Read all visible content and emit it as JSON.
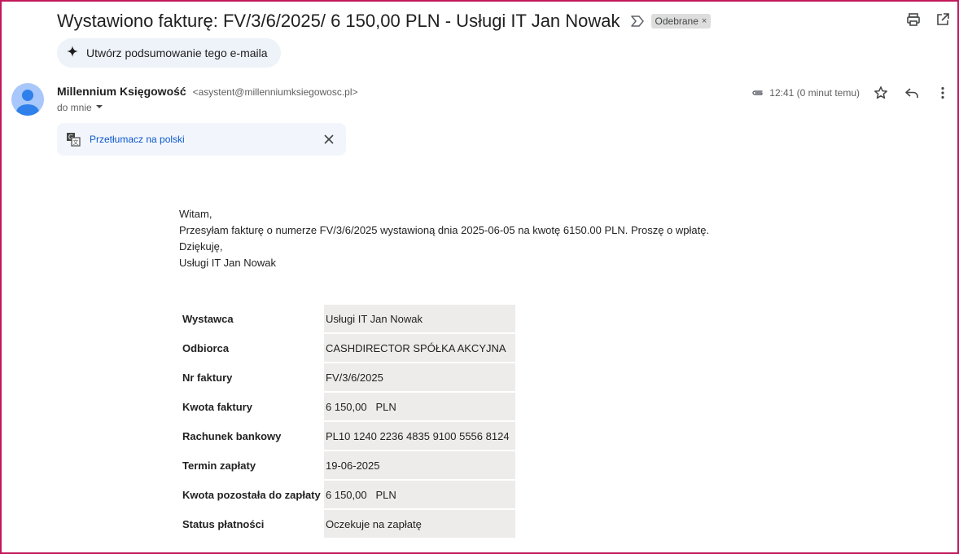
{
  "email": {
    "subject": "Wystawiono fakturę: FV/3/6/2025/ 6 150,00 PLN - Usługi IT Jan Nowak",
    "label": "Odebrane",
    "label_remove": "×",
    "summary_button": "Utwórz podsumowanie tego e-maila",
    "sender_name": "Millennium Księgowość",
    "sender_email": "<asystent@millenniumksiegowosc.pl>",
    "recipient": "do mnie",
    "time": "12:41 (0 minut temu)",
    "translate_link": "Przetłumacz na polski",
    "body": {
      "greeting": "Witam,",
      "line1": "Przesyłam fakturę o numerze FV/3/6/2025 wystawioną dnia 2025-06-05 na kwotę 6150.00 PLN. Proszę o wpłatę.",
      "thanks": "Dziękuję,",
      "signature": "Usługi IT Jan Nowak"
    },
    "invoice_rows": [
      {
        "key": "Wystawca",
        "value": "Usługi IT Jan Nowak"
      },
      {
        "key": "Odbiorca",
        "value": "CASHDIRECTOR SPÓŁKA AKCYJNA"
      },
      {
        "key": "Nr faktury",
        "value": "FV/3/6/2025"
      },
      {
        "key": "Kwota faktury",
        "value": "6 150,00   PLN"
      },
      {
        "key": "Rachunek bankowy",
        "value": "PL10 1240 2236 4835 9100 5556 8124"
      },
      {
        "key": "Termin zapłaty",
        "value": "19-06-2025"
      },
      {
        "key": "Kwota pozostała do zapłaty",
        "value": "6 150,00   PLN"
      },
      {
        "key": "Status płatności",
        "value": "Oczekuje na zapłatę"
      }
    ]
  },
  "icons": {
    "important": "label-important-icon",
    "print": "print-icon",
    "open_new_window": "open-in-new-window-icon",
    "spark": "sparkle-icon",
    "attachment": "paperclip-icon",
    "star": "star-icon",
    "reply": "reply-icon",
    "more": "more-vert-icon",
    "translate": "translate-icon",
    "close": "close-icon",
    "dropdown": "caret-down-icon",
    "avatar": "default-avatar-icon"
  },
  "colors": {
    "frame": "#c2185b",
    "link": "#0b57d0",
    "avatar": "#a8c7fa",
    "summary_bg": "#eef2f9",
    "table_value_bg": "#eeecea"
  }
}
